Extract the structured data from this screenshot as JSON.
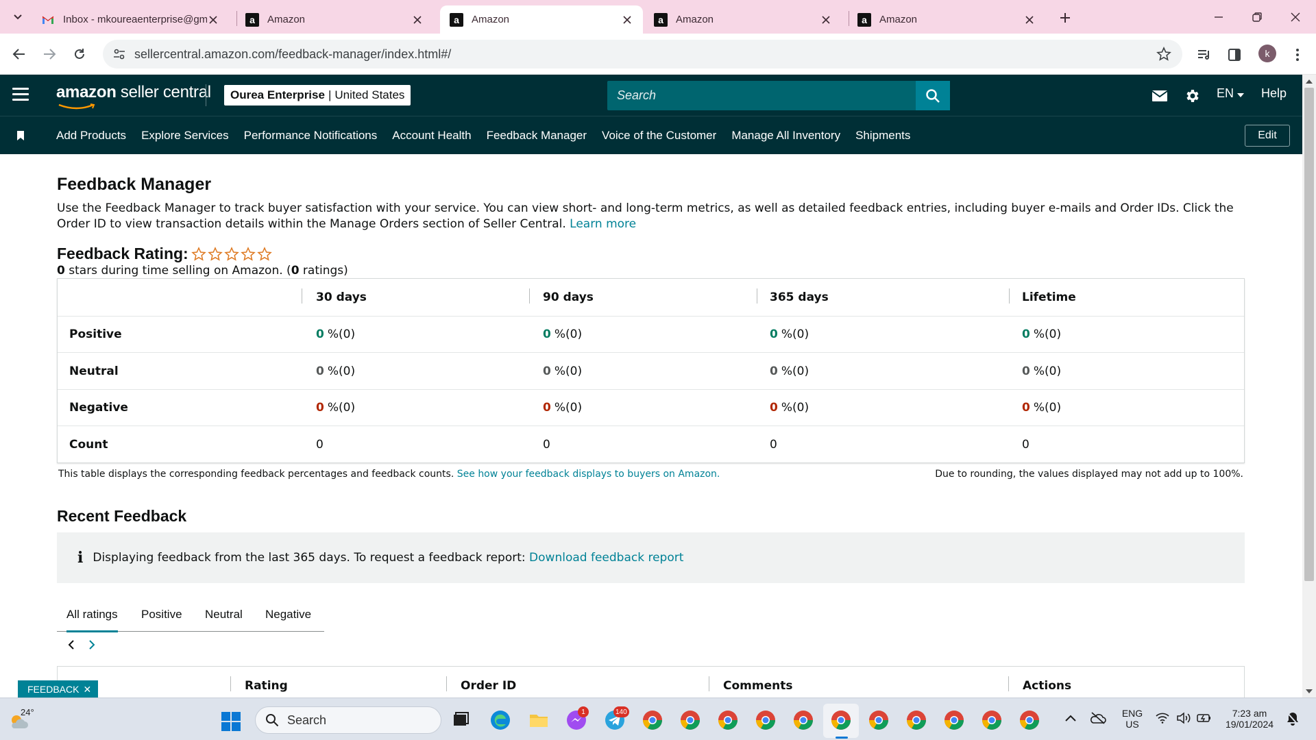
{
  "browser": {
    "tabs": [
      {
        "title": "Inbox - mkoureaenterprise@gm",
        "icon": "gmail-icon",
        "active": false
      },
      {
        "title": "Amazon",
        "icon": "amazon-icon",
        "active": false
      },
      {
        "title": "Amazon",
        "icon": "amazon-icon",
        "active": true
      },
      {
        "title": "Amazon",
        "icon": "amazon-icon",
        "active": false
      },
      {
        "title": "Amazon",
        "icon": "amazon-icon",
        "active": false
      }
    ],
    "url": "sellercentral.amazon.com/feedback-manager/index.html#/",
    "profile_initial": "k"
  },
  "header": {
    "logo_brand": "amazon",
    "logo_suffix": " seller central",
    "store_name": "Ourea Enterprise",
    "store_region": "United States",
    "search_placeholder": "Search",
    "language": "EN",
    "help": "Help"
  },
  "subnav": {
    "items": [
      "Add Products",
      "Explore Services",
      "Performance Notifications",
      "Account Health",
      "Feedback Manager",
      "Voice of the Customer",
      "Manage All Inventory",
      "Shipments"
    ],
    "edit": "Edit"
  },
  "page": {
    "title": "Feedback Manager",
    "intro": "Use the Feedback Manager to track buyer satisfaction with your service. You can view short- and long-term metrics, as well as detailed feedback entries, including buyer e-mails and Order IDs. Click the Order ID to view transaction details within the Manage Orders section of Seller Central.",
    "learn_more": "Learn more",
    "rating_title": "Feedback Rating:",
    "rating_stars": 0,
    "rating_sub_stars": "0",
    "rating_sub_mid": " stars during time selling on Amazon. (",
    "rating_sub_count": "0",
    "rating_sub_end": " ratings)"
  },
  "metrics": {
    "columns": [
      "30 days",
      "90 days",
      "365 days",
      "Lifetime"
    ],
    "rows": [
      {
        "label": "Positive",
        "kind": "pos",
        "values": [
          {
            "v": "0",
            "p": "%(0)"
          },
          {
            "v": "0",
            "p": "%(0)"
          },
          {
            "v": "0",
            "p": "%(0)"
          },
          {
            "v": "0",
            "p": "%(0)"
          }
        ]
      },
      {
        "label": "Neutral",
        "kind": "neu",
        "values": [
          {
            "v": "0",
            "p": "%(0)"
          },
          {
            "v": "0",
            "p": "%(0)"
          },
          {
            "v": "0",
            "p": "%(0)"
          },
          {
            "v": "0",
            "p": "%(0)"
          }
        ]
      },
      {
        "label": "Negative",
        "kind": "neg",
        "values": [
          {
            "v": "0",
            "p": "%(0)"
          },
          {
            "v": "0",
            "p": "%(0)"
          },
          {
            "v": "0",
            "p": "%(0)"
          },
          {
            "v": "0",
            "p": "%(0)"
          }
        ]
      },
      {
        "label": "Count",
        "kind": "count",
        "values": [
          {
            "v": "0",
            "p": ""
          },
          {
            "v": "0",
            "p": ""
          },
          {
            "v": "0",
            "p": ""
          },
          {
            "v": "0",
            "p": ""
          }
        ]
      }
    ],
    "note": "This table displays the corresponding feedback percentages and feedback counts.",
    "note_link": "See how your feedback displays to buyers on Amazon.",
    "note_right": "Due to rounding, the values displayed may not add up to 100%."
  },
  "recent": {
    "title": "Recent Feedback",
    "alert_text": "Displaying feedback from the last 365 days. To request a feedback report:",
    "alert_link": "Download feedback report",
    "tabs": [
      "All ratings",
      "Positive",
      "Neutral",
      "Negative"
    ],
    "active_tab": "All ratings",
    "columns": [
      "Rating",
      "Order ID",
      "Comments",
      "Actions"
    ],
    "feedback_button": "FEEDBACK"
  },
  "taskbar": {
    "temperature": "24°",
    "search_label": "Search",
    "language": "ENG",
    "region": "US",
    "time": "7:23 am",
    "date": "19/01/2024",
    "badges": {
      "messenger": "1",
      "telegram": "140"
    }
  },
  "colors": {
    "header_bg": "#002f36",
    "accent_teal": "#008296",
    "positive": "#067d62",
    "negative": "#b12704",
    "tabbar_bg": "#f7d7e6"
  }
}
